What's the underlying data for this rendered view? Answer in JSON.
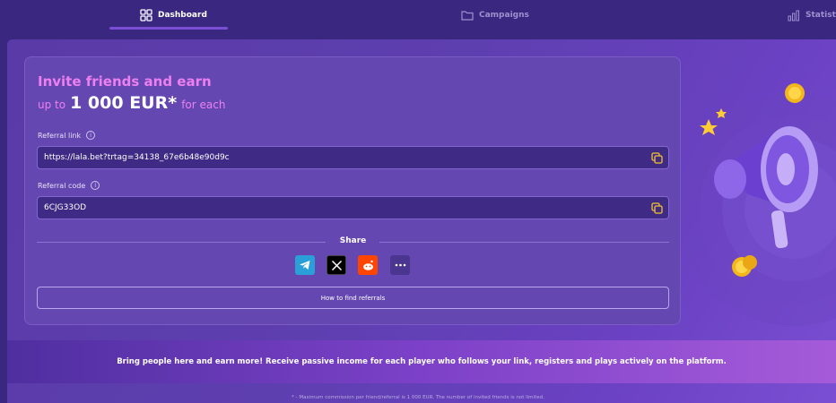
{
  "tabs": [
    {
      "label": "Dashboard",
      "icon": "dashboard-icon",
      "active": true
    },
    {
      "label": "Campaigns",
      "icon": "folder-icon",
      "active": false
    },
    {
      "label": "Statistic",
      "icon": "bar-chart-icon",
      "active": false
    }
  ],
  "invite": {
    "title_line1": "Invite friends and earn",
    "up_to": "up to",
    "amount": "1 000 EUR*",
    "for_each": "for each"
  },
  "referral_link": {
    "label": "Referral link",
    "value": "https://lala.bet?trtag=34138_67e6b48e90d9c"
  },
  "referral_code": {
    "label": "Referral code",
    "value": "6CJG33OD"
  },
  "share": {
    "label": "Share",
    "buttons": [
      {
        "name": "telegram",
        "color": "#2a9fd8"
      },
      {
        "name": "x",
        "color": "#000000"
      },
      {
        "name": "reddit",
        "color": "#ff4500"
      },
      {
        "name": "more",
        "color": "#4a3590"
      }
    ]
  },
  "find_button": "How to find referrals",
  "banner_text": "Bring people here and earn more! Receive passive income for each player who follows your link, registers and plays actively on the platform.",
  "footnote": "* - Maximum commission per friend/referral is 1 000 EUR. The number of invited friends is not limited.",
  "colors": {
    "accent_pink": "#ee7ff0",
    "background": "#3a2780",
    "card": "#6547b2"
  }
}
